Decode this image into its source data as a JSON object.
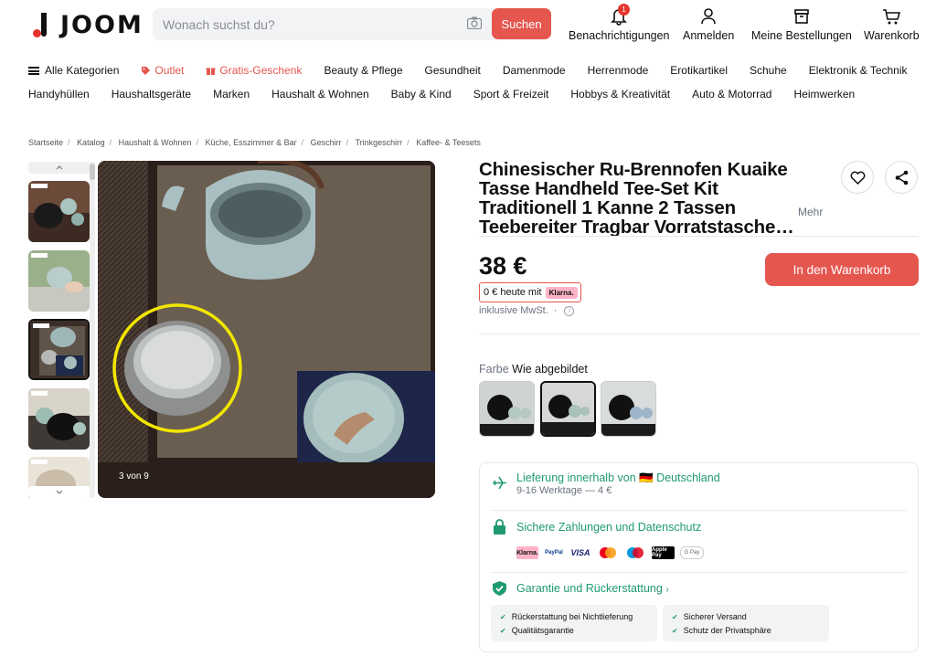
{
  "header": {
    "logo": "JOOM",
    "search_placeholder": "Wonach suchst du?",
    "search_button": "Suchen",
    "notifications_label": "Benachrichtigungen",
    "notifications_count": "1",
    "login_label": "Anmelden",
    "orders_label": "Meine Bestellungen",
    "cart_label": "Warenkorb"
  },
  "nav": {
    "row1": [
      "Alle Kategorien",
      "Outlet",
      "Gratis-Geschenk",
      "Beauty & Pflege",
      "Gesundheit",
      "Damenmode",
      "Herrenmode",
      "Erotikartikel",
      "Schuhe",
      "Elektronik & Technik"
    ],
    "row2": [
      "Handyhüllen",
      "Haushaltsgeräte",
      "Marken",
      "Haushalt & Wohnen",
      "Baby & Kind",
      "Sport & Freizeit",
      "Hobbys & Kreativität",
      "Auto & Motorrad",
      "Heimwerken"
    ]
  },
  "breadcrumb": [
    "Startseite",
    "Katalog",
    "Haushalt & Wohnen",
    "Küche, Esszimmer & Bar",
    "Geschirr",
    "Trinkgeschirr",
    "Kaffee- & Teesets"
  ],
  "gallery": {
    "counter": "3 von 9",
    "selected_index": 3,
    "total": 9
  },
  "product": {
    "title": "Chinesischer Ru-Brennofen Kuaike Tasse Handheld Tee-Set Kit Traditionell 1 Kanne 2 Tassen Teebereiter Tragbar Vorratstasche…",
    "more": "Mehr",
    "price": "38 €",
    "klarna_text": "0 € heute mit",
    "klarna_logo": "Klarna.",
    "vat": "inklusive MwSt.",
    "vat_sep": "·",
    "add_to_cart": "In den Warenkorb",
    "color_key": "Farbe",
    "color_value": "Wie abgebildet"
  },
  "info": {
    "shipping_title": "Lieferung innerhalb von 🇩🇪 Deutschland",
    "shipping_sub": "9-16 Werktage — 4 €",
    "payment_title": "Sichere Zahlungen und Datenschutz",
    "payment_methods": [
      "Klarna.",
      "PayPal",
      "VISA",
      "mastercard",
      "maestro",
      "Apple Pay",
      "G Pay"
    ],
    "guarantee_title": "Garantie und Rückerstattung",
    "guarantee_left": [
      "Rückerstattung bei Nichtlieferung",
      "Qualitätsgarantie"
    ],
    "guarantee_right": [
      "Sicherer Versand",
      "Schutz der Privatsphäre"
    ]
  },
  "colors": {
    "accent": "#e5564f",
    "green": "#1f9a6f",
    "brand_red": "#e5352d"
  }
}
